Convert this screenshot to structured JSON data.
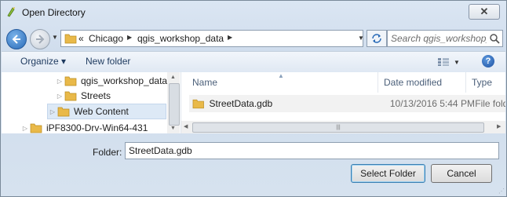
{
  "window": {
    "title": "Open Directory",
    "close_glyph": "✕"
  },
  "address": {
    "crumbs": [
      "«",
      "Chicago",
      "qgis_workshop_data"
    ],
    "search_placeholder": "Search qgis_workshop_d..."
  },
  "toolbar": {
    "organize_label": "Organize ▾",
    "new_folder_label": "New folder",
    "help_glyph": "?"
  },
  "nav_tree": {
    "items": [
      {
        "label": "qgis_workshop_data",
        "expander": "▷"
      },
      {
        "label": "Streets",
        "expander": "▷"
      },
      {
        "label": "Web Content",
        "expander": "▷",
        "selected": true
      },
      {
        "label": "iPF8300-Drv-Win64-431",
        "expander": "▷"
      }
    ]
  },
  "file_list": {
    "columns": [
      "Name",
      "Date modified",
      "Type"
    ],
    "rows": [
      {
        "name": "StreetData.gdb",
        "date_modified": "10/13/2016 5:44 PM",
        "type": "File folder"
      }
    ]
  },
  "footer": {
    "folder_label": "Folder:",
    "folder_value": "StreetData.gdb",
    "select_label": "Select Folder",
    "cancel_label": "Cancel"
  },
  "colors": {
    "accent": "#2a6bb8",
    "folder": "#e9b949",
    "frame": "#cfdcec"
  },
  "icons": [
    "folder-icon",
    "search-icon",
    "refresh-icon",
    "help-icon",
    "back-arrow-icon",
    "forward-arrow-icon",
    "view-icon"
  ]
}
